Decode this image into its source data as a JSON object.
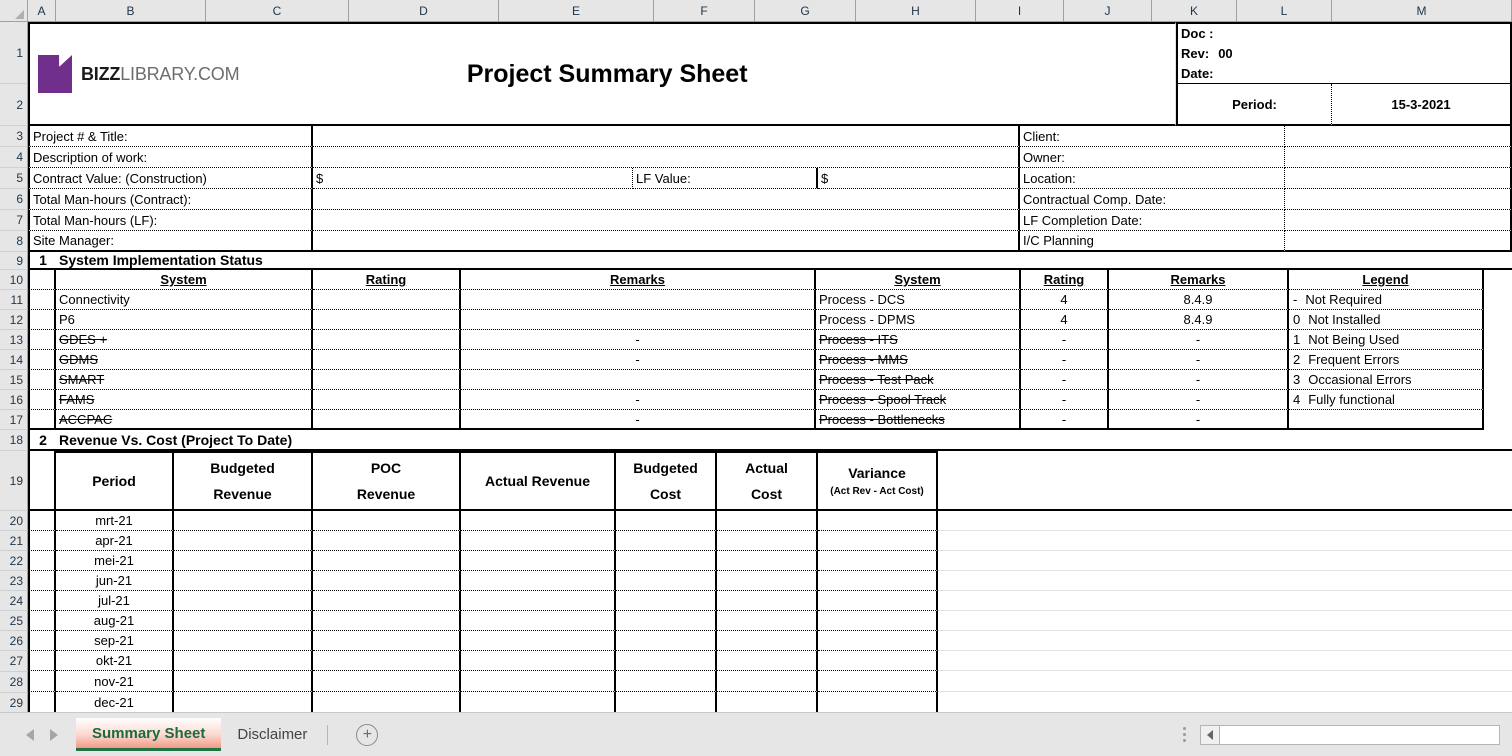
{
  "spreadsheet": {
    "column_headers": [
      "A",
      "B",
      "C",
      "D",
      "E",
      "F",
      "G",
      "H",
      "I",
      "J",
      "K",
      "L",
      "M"
    ],
    "row_headers": [
      "1",
      "2",
      "3",
      "4",
      "5",
      "6",
      "7",
      "8",
      "9",
      "10",
      "11",
      "12",
      "13",
      "14",
      "15",
      "16",
      "17",
      "18",
      "19",
      "20",
      "21",
      "22",
      "23",
      "24",
      "25",
      "26",
      "27",
      "28",
      "29"
    ]
  },
  "brand": {
    "bold_part": "BIZZ",
    "light_part": "LIBRARY.COM",
    "logo_color": "#702f8a"
  },
  "header": {
    "title": "Project Summary Sheet",
    "doc_label": "Doc :",
    "rev_label": "Rev:",
    "rev_value": "00",
    "date_label": "Date:",
    "period_label": "Period:",
    "period_value": "15-3-2021"
  },
  "project_info": {
    "left": [
      {
        "label": "Project # & Title:",
        "value": ""
      },
      {
        "label": "Description of work:",
        "value": ""
      },
      {
        "label": "Contract Value: (Construction)",
        "value": "$"
      },
      {
        "label": "Total Man-hours (Contract):",
        "value": ""
      },
      {
        "label": "Total Man-hours (LF):",
        "value": ""
      },
      {
        "label": "Site Manager:",
        "value": ""
      }
    ],
    "lf_value_label": "LF Value:",
    "lf_value_amount": "$",
    "right": [
      {
        "label": "Client:",
        "value": ""
      },
      {
        "label": "Owner:",
        "value": ""
      },
      {
        "label": "Location:",
        "value": ""
      },
      {
        "label": "Contractual Comp. Date:",
        "value": ""
      },
      {
        "label": "LF Completion Date:",
        "value": ""
      },
      {
        "label": "I/C Planning",
        "value": ""
      }
    ]
  },
  "section1": {
    "number": "1",
    "title": "System Implementation Status",
    "headers": {
      "system": "System",
      "rating": "Rating",
      "remarks": "Remarks",
      "legend": "Legend"
    },
    "left_rows": [
      {
        "system": "Connectivity",
        "rating": "",
        "remarks": "",
        "strike": false
      },
      {
        "system": "P6",
        "rating": "",
        "remarks": "",
        "strike": false
      },
      {
        "system": "GDES +",
        "rating": "",
        "remarks": "-",
        "strike": true
      },
      {
        "system": "GDMS",
        "rating": "",
        "remarks": "-",
        "strike": true
      },
      {
        "system": "SMART",
        "rating": "",
        "remarks": "",
        "strike": true
      },
      {
        "system": "FAMS",
        "rating": "",
        "remarks": "-",
        "strike": true
      },
      {
        "system": "ACCPAC",
        "rating": "",
        "remarks": "-",
        "strike": true
      }
    ],
    "right_rows": [
      {
        "system": "Process - DCS",
        "rating": "4",
        "remarks": "8.4.9",
        "strike": false
      },
      {
        "system": "Process - DPMS",
        "rating": "4",
        "remarks": "8.4.9",
        "strike": false
      },
      {
        "system": "Process -  ITS",
        "rating": "-",
        "remarks": "-",
        "strike": true
      },
      {
        "system": "Process -  MMS",
        "rating": "-",
        "remarks": "-",
        "strike": true
      },
      {
        "system": "Process -  Test Pack",
        "rating": "-",
        "remarks": "-",
        "strike": true
      },
      {
        "system": "Process -  Spool Track",
        "rating": "-",
        "remarks": "-",
        "strike": true
      },
      {
        "system": "Process -  Bottlenecks",
        "rating": "-",
        "remarks": "-",
        "strike": true
      }
    ],
    "legend_rows": [
      {
        "code": "-",
        "text": "Not Required"
      },
      {
        "code": "0",
        "text": "Not Installed"
      },
      {
        "code": "1",
        "text": "Not Being Used"
      },
      {
        "code": "2",
        "text": "Frequent Errors"
      },
      {
        "code": "3",
        "text": "Occasional Errors"
      },
      {
        "code": "4",
        "text": "Fully functional"
      }
    ]
  },
  "section2": {
    "number": "2",
    "title": "Revenue Vs. Cost (Project To Date)",
    "columns": [
      {
        "line1": "Period",
        "line2": ""
      },
      {
        "line1": "Budgeted",
        "line2": "Revenue"
      },
      {
        "line1": "POC",
        "line2": "Revenue"
      },
      {
        "line1": "Actual Revenue",
        "line2": ""
      },
      {
        "line1": "Budgeted",
        "line2": "Cost"
      },
      {
        "line1": "Actual",
        "line2": "Cost"
      },
      {
        "line1": "Variance",
        "line2": "(Act Rev - Act Cost)"
      }
    ],
    "rows": [
      {
        "period": "mrt-21",
        "budgeted_revenue": "",
        "poc_revenue": "",
        "actual_revenue": "",
        "budgeted_cost": "",
        "actual_cost": "",
        "variance": ""
      },
      {
        "period": "apr-21",
        "budgeted_revenue": "",
        "poc_revenue": "",
        "actual_revenue": "",
        "budgeted_cost": "",
        "actual_cost": "",
        "variance": ""
      },
      {
        "period": "mei-21",
        "budgeted_revenue": "",
        "poc_revenue": "",
        "actual_revenue": "",
        "budgeted_cost": "",
        "actual_cost": "",
        "variance": ""
      },
      {
        "period": "jun-21",
        "budgeted_revenue": "",
        "poc_revenue": "",
        "actual_revenue": "",
        "budgeted_cost": "",
        "actual_cost": "",
        "variance": ""
      },
      {
        "period": "jul-21",
        "budgeted_revenue": "",
        "poc_revenue": "",
        "actual_revenue": "",
        "budgeted_cost": "",
        "actual_cost": "",
        "variance": ""
      },
      {
        "period": "aug-21",
        "budgeted_revenue": "",
        "poc_revenue": "",
        "actual_revenue": "",
        "budgeted_cost": "",
        "actual_cost": "",
        "variance": ""
      },
      {
        "period": "sep-21",
        "budgeted_revenue": "",
        "poc_revenue": "",
        "actual_revenue": "",
        "budgeted_cost": "",
        "actual_cost": "",
        "variance": ""
      },
      {
        "period": "okt-21",
        "budgeted_revenue": "",
        "poc_revenue": "",
        "actual_revenue": "",
        "budgeted_cost": "",
        "actual_cost": "",
        "variance": ""
      },
      {
        "period": "nov-21",
        "budgeted_revenue": "",
        "poc_revenue": "",
        "actual_revenue": "",
        "budgeted_cost": "",
        "actual_cost": "",
        "variance": ""
      },
      {
        "period": "dec-21",
        "budgeted_revenue": "",
        "poc_revenue": "",
        "actual_revenue": "",
        "budgeted_cost": "",
        "actual_cost": "",
        "variance": ""
      }
    ]
  },
  "tabs": {
    "sheets": [
      {
        "name": "Summary Sheet",
        "active": true
      },
      {
        "name": "Disclaimer",
        "active": false
      }
    ],
    "add_sheet_glyph": "+"
  }
}
